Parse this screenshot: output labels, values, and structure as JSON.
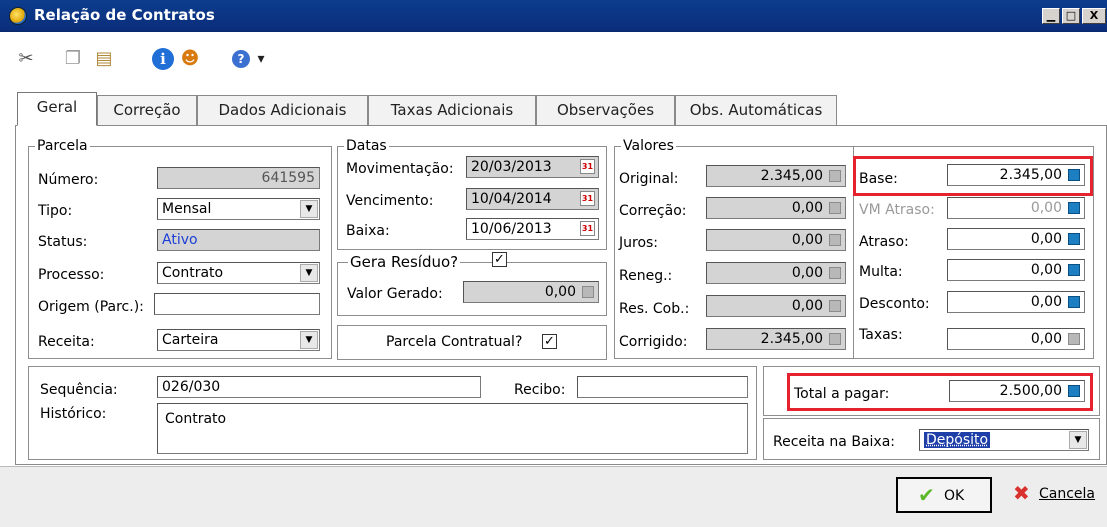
{
  "window": {
    "title": "Relação de Contratos",
    "btn_min": "▁",
    "btn_max": "□",
    "btn_close": "X"
  },
  "toolbar": {
    "items": [
      {
        "name": "cut-icon",
        "glyph": "✂"
      },
      {
        "name": "copy-icon",
        "glyph": "❐"
      },
      {
        "name": "paste-icon",
        "glyph": "▤"
      },
      {
        "name": "info-icon",
        "glyph": "ℹ"
      },
      {
        "name": "user-icon",
        "glyph": "☻"
      },
      {
        "name": "help-icon",
        "glyph": "?"
      },
      {
        "name": "dropdown-arrow-icon",
        "glyph": "▾"
      }
    ]
  },
  "tabs": [
    {
      "label": "Geral",
      "active": true
    },
    {
      "label": "Correção"
    },
    {
      "label": "Dados Adicionais"
    },
    {
      "label": "Taxas Adicionais"
    },
    {
      "label": "Observações"
    },
    {
      "label": "Obs. Automáticas"
    }
  ],
  "parcela": {
    "legend": "Parcela",
    "numero_label": "Número:",
    "numero": "641595",
    "tipo_label": "Tipo:",
    "tipo": "Mensal",
    "status_label": "Status:",
    "status": "Ativo",
    "processo_label": "Processo:",
    "processo": "Contrato",
    "origem_label": "Origem (Parc.):",
    "origem": "",
    "receita_label": "Receita:",
    "receita": "Carteira"
  },
  "datas": {
    "legend": "Datas",
    "mov_label": "Movimentação:",
    "mov": "20/03/2013",
    "venc_label": "Vencimento:",
    "venc": "10/04/2014",
    "baixa_label": "Baixa:",
    "baixa": "10/06/2013",
    "residuo_label": "Gera Resíduo?",
    "residuo_checked": true,
    "valor_gerado_label": "Valor Gerado:",
    "valor_gerado": "0,00",
    "contratual_label": "Parcela Contratual?",
    "contratual_checked": true,
    "check_glyph": "✓",
    "calendar_glyph": "31"
  },
  "valores": {
    "legend": "Valores",
    "original_label": "Original:",
    "original": "2.345,00",
    "correcao_label": "Correção:",
    "correcao": "0,00",
    "juros_label": "Juros:",
    "juros": "0,00",
    "reneg_label": "Reneg.:",
    "reneg": "0,00",
    "rescob_label": "Res. Cob.:",
    "rescob": "0,00",
    "corrigido_label": "Corrigido:",
    "corrigido": "2.345,00"
  },
  "valores_dir": {
    "base_label": "Base:",
    "base": "2.345,00",
    "vm_label": "VM Atraso:",
    "vm": "0,00",
    "atraso_label": "Atraso:",
    "atraso": "0,00",
    "multa_label": "Multa:",
    "multa": "0,00",
    "desconto_label": "Desconto:",
    "desconto": "0,00",
    "taxas_label": "Taxas:",
    "taxas": "0,00"
  },
  "lower": {
    "sequencia_label": "Sequência:",
    "sequencia": "026/030",
    "recibo_label": "Recibo:",
    "recibo": "",
    "historico_label": "Histórico:",
    "historico": "Contrato"
  },
  "totals": {
    "total_label": "Total a pagar:",
    "total": "2.500,00",
    "receita_baixa_label": "Receita na Baixa:",
    "receita_baixa": "Depósito"
  },
  "buttons": {
    "ok": "OK",
    "cancel": "Cancela",
    "ok_glyph": "✔",
    "cancel_glyph": "✖"
  },
  "colors": {
    "highlight": "#e4232e",
    "status_text": "#1c3fd6",
    "selection": "#1f3fa8"
  }
}
